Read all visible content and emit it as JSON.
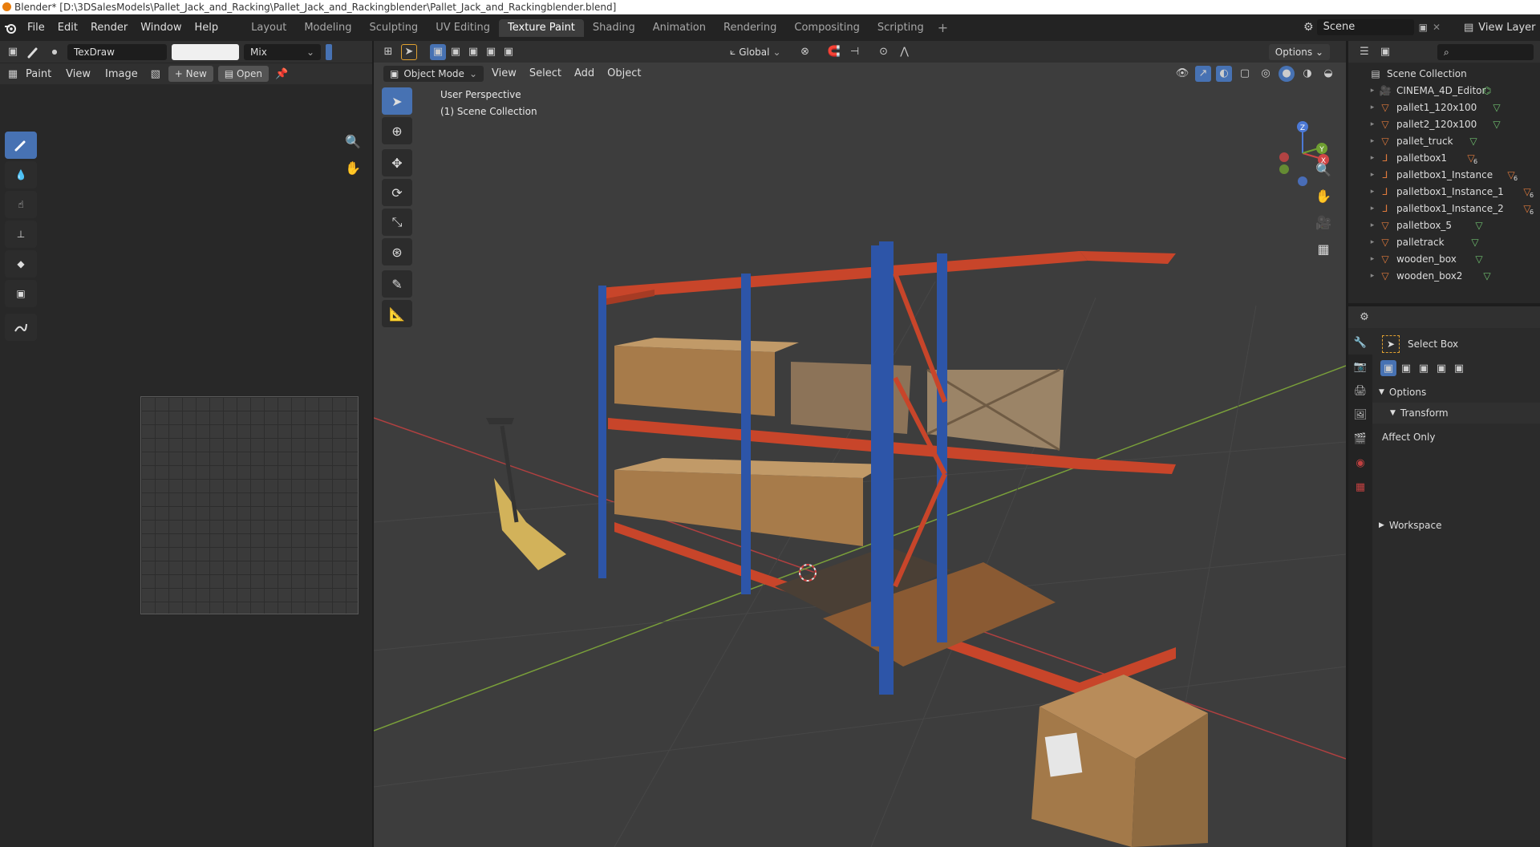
{
  "window": {
    "title": "Blender* [D:\\3DSalesModels\\Pallet_Jack_and_Racking\\Pallet_Jack_and_Rackingblender\\Pallet_Jack_and_Rackingblender.blend]"
  },
  "menu": {
    "items": [
      "File",
      "Edit",
      "Render",
      "Window",
      "Help"
    ]
  },
  "workspaces": {
    "tabs": [
      "Layout",
      "Modeling",
      "Sculpting",
      "UV Editing",
      "Texture Paint",
      "Shading",
      "Animation",
      "Rendering",
      "Compositing",
      "Scripting"
    ],
    "active": "Texture Paint"
  },
  "scene": {
    "name": "Scene",
    "view_layer": "View Layer"
  },
  "image_editor": {
    "brush_name": "TexDraw",
    "blend_mode": "Mix",
    "mode": "Paint",
    "menus": [
      "View",
      "Image"
    ],
    "new_label": "New",
    "open_label": "Open"
  },
  "viewport": {
    "orientation": "Global",
    "options_label": "Options",
    "mode": "Object Mode",
    "menus": [
      "View",
      "Select",
      "Add",
      "Object"
    ],
    "perspective_label": "User Perspective",
    "collection_label": "(1) Scene Collection"
  },
  "outliner": {
    "root": "Scene Collection",
    "items": [
      {
        "name": "CINEMA_4D_Editor",
        "type": "camera"
      },
      {
        "name": "pallet1_120x100",
        "type": "mesh"
      },
      {
        "name": "pallet2_120x100",
        "type": "mesh"
      },
      {
        "name": "pallet_truck",
        "type": "mesh"
      },
      {
        "name": "palletbox1",
        "type": "empty",
        "badge": "6"
      },
      {
        "name": "palletbox1_Instance",
        "type": "empty",
        "badge": "6"
      },
      {
        "name": "palletbox1_Instance_1",
        "type": "empty",
        "badge": "6"
      },
      {
        "name": "palletbox1_Instance_2",
        "type": "empty",
        "badge": "6"
      },
      {
        "name": "palletbox_5",
        "type": "mesh"
      },
      {
        "name": "palletrack",
        "type": "mesh"
      },
      {
        "name": "wooden_box",
        "type": "mesh"
      },
      {
        "name": "wooden_box2",
        "type": "mesh"
      }
    ]
  },
  "properties": {
    "tool_name": "Select Box",
    "options_label": "Options",
    "transform_label": "Transform",
    "affect_only_label": "Affect Only",
    "workspace_label": "Workspace"
  },
  "colors": {
    "accent": "#4772b3",
    "rack_orange": "#c8452a",
    "rack_blue": "#2d55a8",
    "grid_x": "#b04040",
    "grid_y": "#7aa03a"
  }
}
